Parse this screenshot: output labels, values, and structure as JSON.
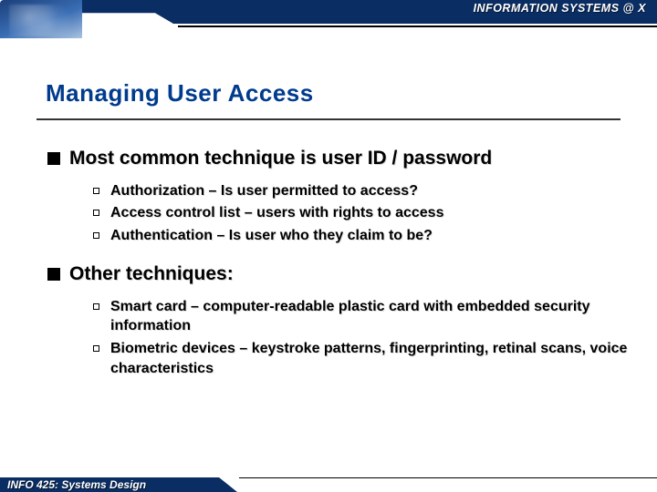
{
  "header": {
    "program": "INFORMATION SYSTEMS @ X"
  },
  "title": "Managing User Access",
  "bullets": [
    {
      "text": "Most common technique is user ID / password",
      "subs": [
        "Authorization – Is user permitted to access?",
        "Access control list – users with rights to access",
        "Authentication – Is user who they claim to be?"
      ]
    },
    {
      "text": "Other techniques:",
      "subs": [
        "Smart card – computer-readable plastic card with embedded security information",
        "Biometric devices – keystroke patterns, fingerprinting, retinal scans, voice characteristics"
      ]
    }
  ],
  "footer": {
    "course": "INFO 425: Systems Design"
  }
}
